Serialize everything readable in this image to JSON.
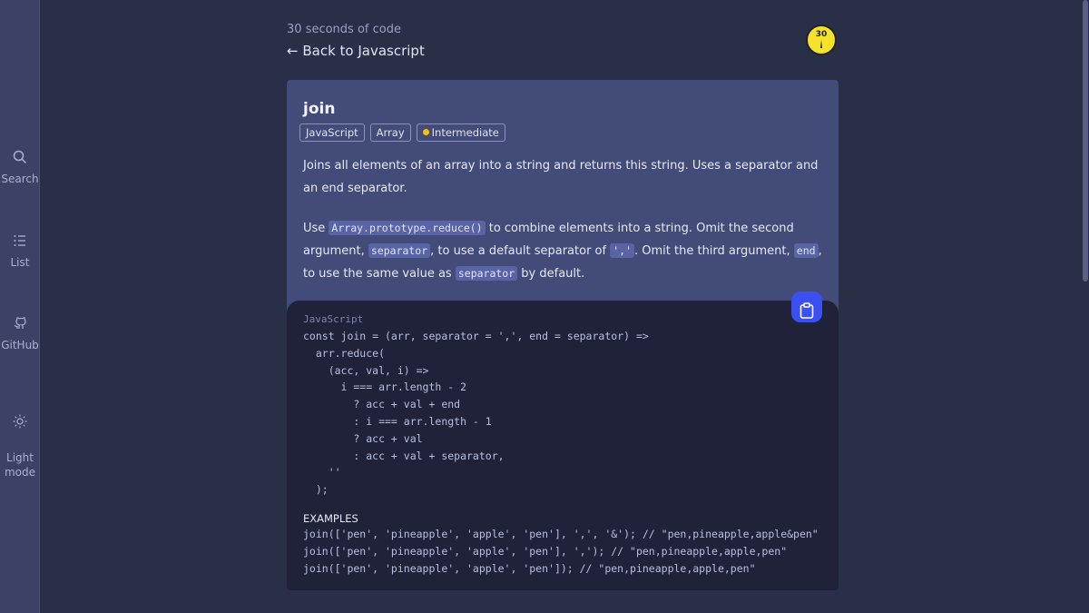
{
  "sidebar": {
    "items": [
      {
        "label": "Search",
        "icon": "search-icon"
      },
      {
        "label": "List",
        "icon": "list-icon"
      },
      {
        "label": "GitHub",
        "icon": "github-icon"
      },
      {
        "label": "Light\nmode",
        "icon": "sun-icon"
      }
    ]
  },
  "header": {
    "site_name": "30 seconds of code",
    "back_label": "← Back to Javascript",
    "logo_text": "30"
  },
  "snippet": {
    "title": "join",
    "tags": [
      "JavaScript",
      "Array",
      "Intermediate"
    ],
    "difficulty_color": "#f1c40f",
    "description": "Joins all elements of an array into a string and returns this string. Uses a separator and an end separator.",
    "use_prefix": "Use ",
    "code_reduce": "Array.prototype.reduce()",
    "use_mid1": " to combine elements into a string. Omit the second argument, ",
    "code_separator": "separator",
    "use_mid2": ", to use a default separator of ",
    "code_comma": "','",
    "use_mid3": ". Omit the third argument, ",
    "code_end": "end",
    "use_mid4": ", to use the same value as ",
    "code_separator2": "separator",
    "use_suffix": " by default."
  },
  "code": {
    "language": "JavaScript",
    "lines": [
      "const join = (arr, separator = ',', end = separator) =>",
      "  arr.reduce(",
      "    (acc, val, i) =>",
      "      i === arr.length - 2",
      "        ? acc + val + end",
      "        : i === arr.length - 1",
      "        ? acc + val",
      "        : acc + val + separator,",
      "    ''",
      "  );"
    ]
  },
  "examples": {
    "label": "EXAMPLES",
    "lines": [
      "join(['pen', 'pineapple', 'apple', 'pen'], ',', '&'); // \"pen,pineapple,apple&pen\"",
      "join(['pen', 'pineapple', 'apple', 'pen'], ','); // \"pen,pineapple,apple,pen\"",
      "join(['pen', 'pineapple', 'apple', 'pen']); // \"pen,pineapple,apple,pen\""
    ]
  },
  "colors": {
    "background": "#2a2f48",
    "card": "#434b78",
    "code_bg": "#1f2238",
    "copy_button": "#3a50f0",
    "logo": "#f5e22a"
  }
}
